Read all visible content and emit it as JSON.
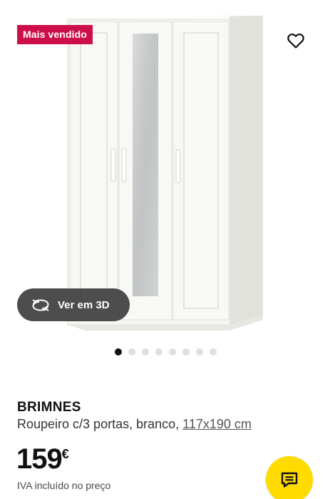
{
  "badge": {
    "label": "Mais vendido"
  },
  "image": {
    "gallery_count": 8,
    "active_index": 0,
    "view3d_label": "Ver em 3D"
  },
  "product": {
    "name": "BRIMNES",
    "description": "Roupeiro c/3 portas, branco,",
    "size": "117x190 cm",
    "price": "159",
    "currency": "€",
    "vat_note": "IVA incluído no preço"
  },
  "icons": {
    "favourite": "heart-outline-icon",
    "view3d": "rotate-3d-icon",
    "chat": "chat-bubble-icon"
  },
  "colors": {
    "badge": "#cc0f49",
    "chat_button": "#ffdb00",
    "view3d_button": "#3e3e3e"
  }
}
